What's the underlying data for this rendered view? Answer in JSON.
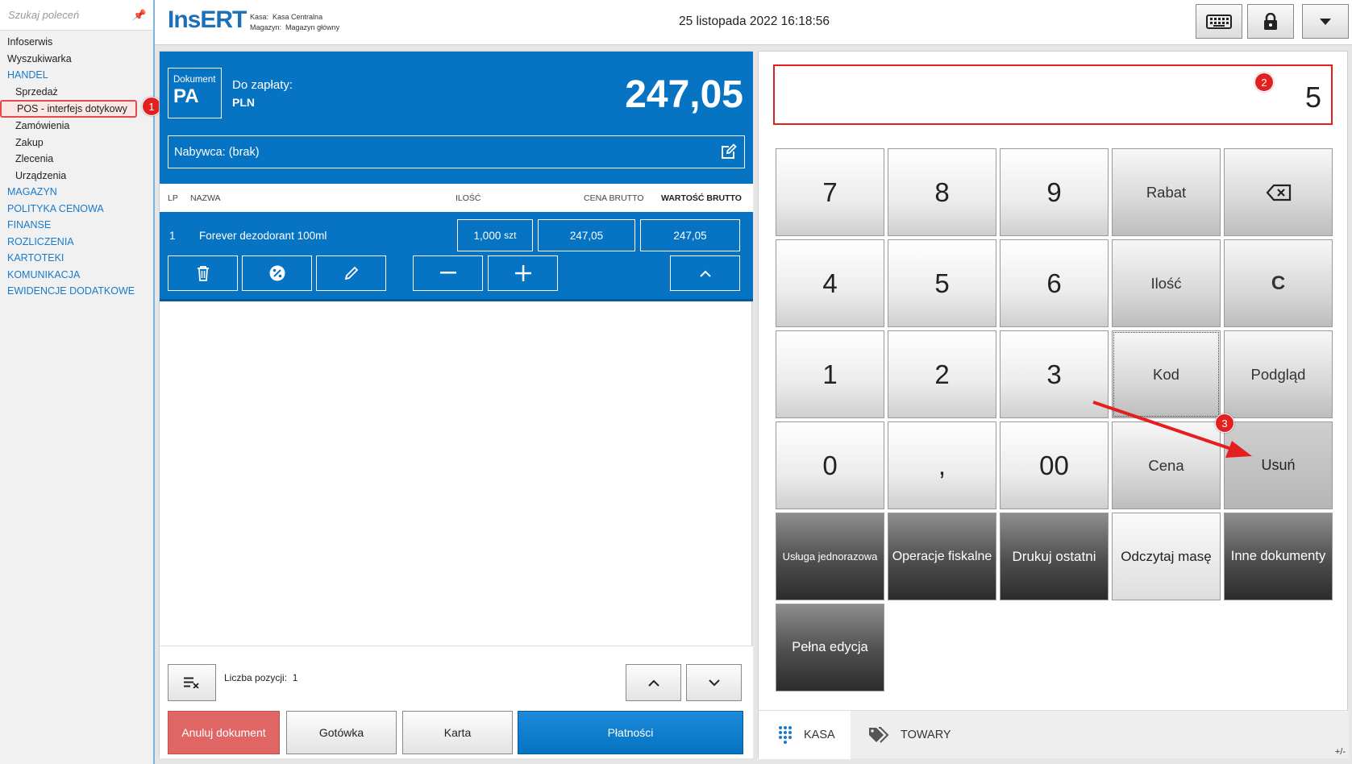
{
  "sidebar": {
    "search_placeholder": "Szukaj poleceń",
    "items": [
      {
        "label": "Infoserwis"
      },
      {
        "label": "Wyszukiwarka"
      },
      {
        "label": "HANDEL"
      },
      {
        "label": "Sprzedaż"
      },
      {
        "label": "POS - interfejs dotykowy"
      },
      {
        "label": "Zamówienia"
      },
      {
        "label": "Zakup"
      },
      {
        "label": "Zlecenia"
      },
      {
        "label": "Urządzenia"
      },
      {
        "label": "MAGAZYN"
      },
      {
        "label": "POLITYKA CENOWA"
      },
      {
        "label": "FINANSE"
      },
      {
        "label": "ROZLICZENIA"
      },
      {
        "label": "KARTOTEKI"
      },
      {
        "label": "KOMUNIKACJA"
      },
      {
        "label": "EWIDENCJE DODATKOWE"
      }
    ]
  },
  "annotations": {
    "b1": "1",
    "b2": "2",
    "b3": "3"
  },
  "header": {
    "logo": "InsERT",
    "kasa_label": "Kasa:",
    "kasa_value": "Kasa Centralna",
    "magazyn_label": "Magazyn:",
    "magazyn_value": "Magazyn główny",
    "datetime": "25 listopada 2022 16:18:56"
  },
  "document": {
    "label": "Dokument",
    "type": "PA",
    "to_pay_label": "Do zapłaty:",
    "currency": "PLN",
    "amount": "247,05",
    "buyer": "Nabywca: (brak)"
  },
  "table": {
    "headers": {
      "lp": "LP",
      "name": "NAZWA",
      "qty": "ILOŚĆ",
      "price": "CENA BRUTTO",
      "value": "WARTOŚĆ BRUTTO"
    },
    "rows": [
      {
        "lp": "1",
        "name": "Forever dezodorant 100ml",
        "qty": "1,000",
        "unit": "szt",
        "price": "247,05",
        "value": "247,05"
      }
    ]
  },
  "footer": {
    "positions_label": "Liczba pozycji:",
    "positions_count": "1",
    "cancel": "Anuluj dokument",
    "cash": "Gotówka",
    "card": "Karta",
    "payments": "Płatności"
  },
  "keypad": {
    "display_value": "5",
    "keys": {
      "k7": "7",
      "k8": "8",
      "k9": "9",
      "rabat": "Rabat",
      "k4": "4",
      "k5": "5",
      "k6": "6",
      "ilosc": "Ilość",
      "clear": "C",
      "k1": "1",
      "k2": "2",
      "k3": "3",
      "kod": "Kod",
      "podglad": "Podgląd",
      "k0": "0",
      "comma": ",",
      "k00": "00",
      "cena": "Cena",
      "usun": "Usuń",
      "usluga": "Usługa jednorazowa",
      "fiskalne": "Operacje fiskalne",
      "drukuj": "Drukuj ostatni",
      "masa": "Odczytaj masę",
      "inne": "Inne dokumenty",
      "pelna": "Pełna edycja"
    }
  },
  "tabs": {
    "kasa": "KASA",
    "towary": "TOWARY",
    "corner": "+/-"
  },
  "colors": {
    "accent": "#0673c3",
    "cancel": "#e06666",
    "highlight": "#e31f1f"
  }
}
